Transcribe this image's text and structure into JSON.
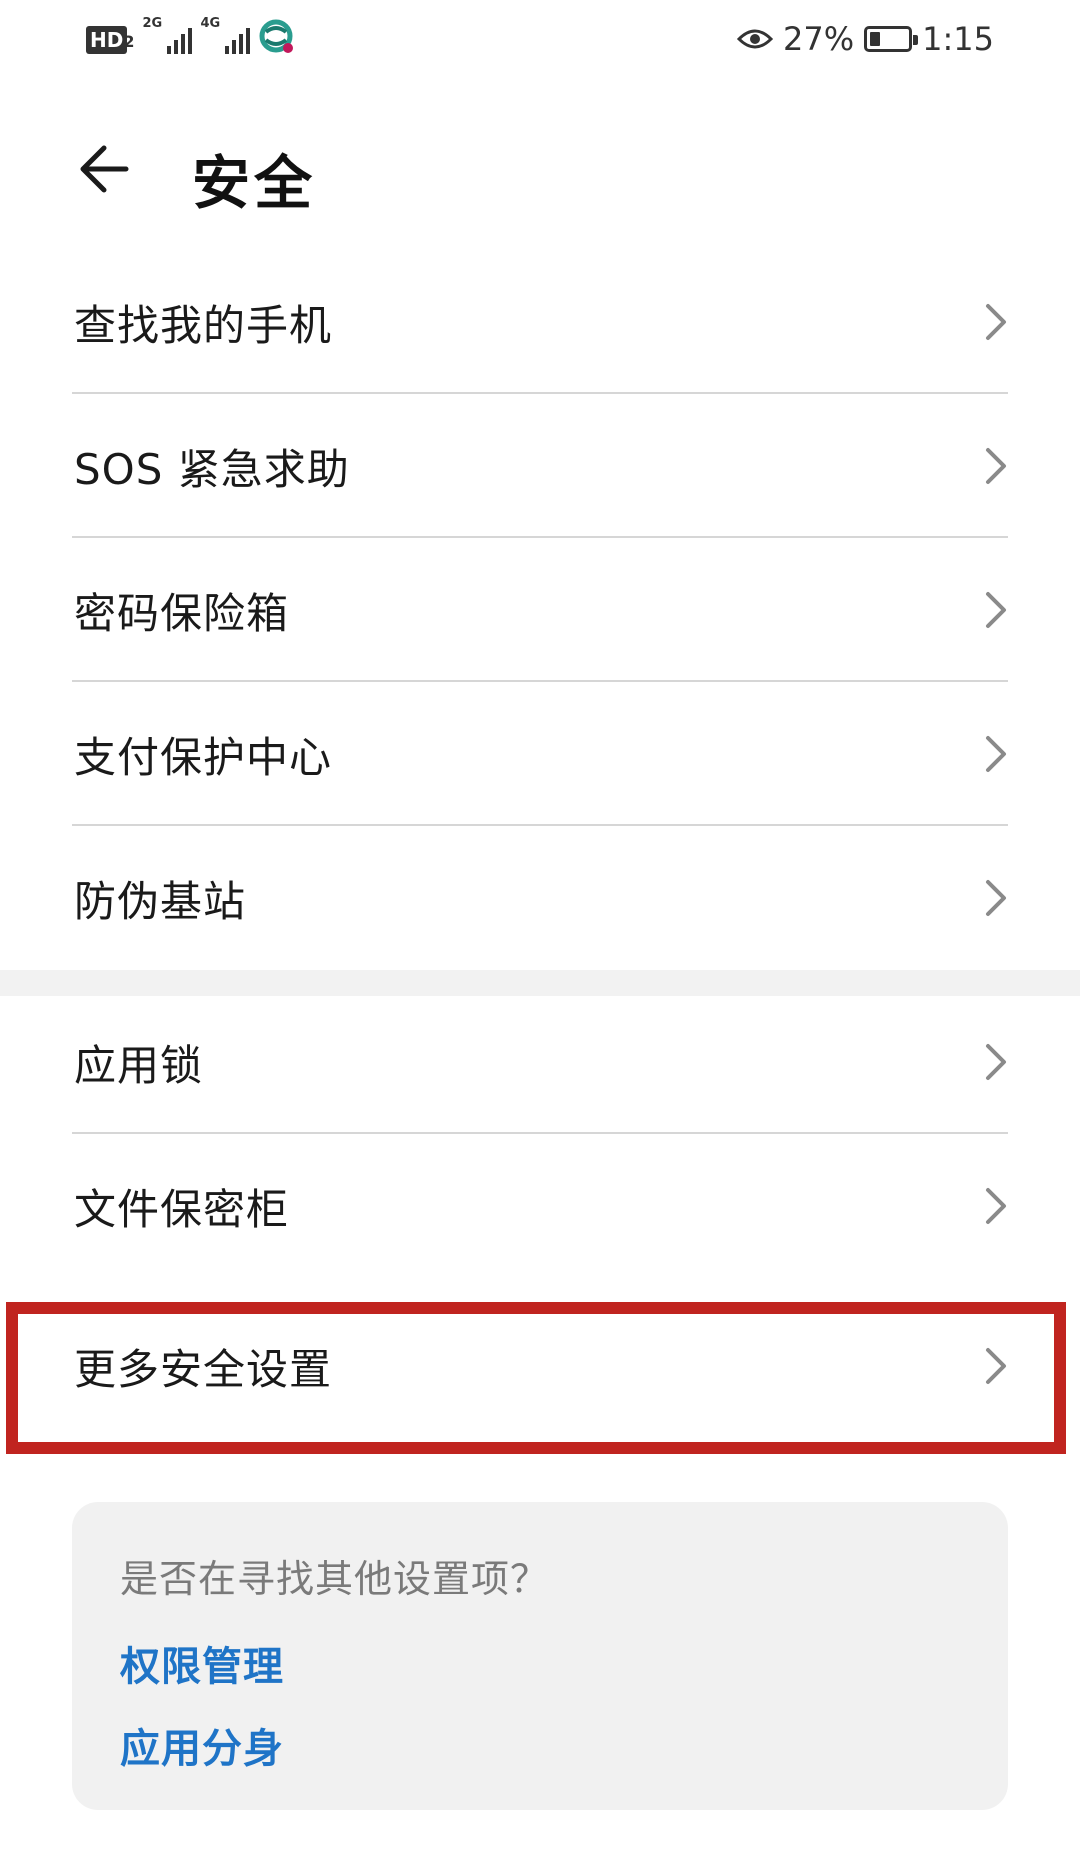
{
  "status_bar": {
    "hd_label": "HD",
    "hd_sub": "2",
    "net1": "2G",
    "net2": "4G",
    "battery_percent_text": "27%",
    "battery_level": 0.27,
    "time": "1:15"
  },
  "header": {
    "title": "安全"
  },
  "sections": [
    {
      "items": [
        {
          "label": "查找我的手机"
        },
        {
          "label": "SOS 紧急求助"
        },
        {
          "label": "密码保险箱"
        },
        {
          "label": "支付保护中心"
        },
        {
          "label": "防伪基站"
        }
      ]
    },
    {
      "items": [
        {
          "label": "应用锁"
        },
        {
          "label": "文件保密柜"
        },
        {
          "label": "更多安全设置"
        }
      ]
    }
  ],
  "suggestion_card": {
    "question": "是否在寻找其他设置项？",
    "links": [
      "权限管理",
      "应用分身"
    ]
  },
  "colors": {
    "highlight_border": "#c0241f",
    "link": "#1f74c7"
  }
}
